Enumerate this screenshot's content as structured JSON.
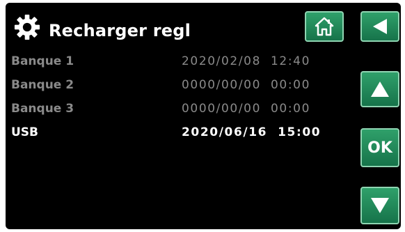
{
  "header": {
    "title": "Recharger regl",
    "icon": "gear-icon"
  },
  "buttons": {
    "home_icon": "home-icon",
    "back_icon": "back-arrow-icon",
    "up_icon": "up-arrow-icon",
    "ok_label": "OK",
    "down_icon": "down-arrow-icon"
  },
  "slots": [
    {
      "name": "Banque 1",
      "datetime": "2020/02/08  12:40"
    },
    {
      "name": "Banque 2",
      "datetime": "0000/00/00  00:00"
    },
    {
      "name": "Banque 3",
      "datetime": "0000/00/00  00:00"
    },
    {
      "name": "USB",
      "datetime": "2020/06/16  15:00"
    }
  ],
  "colors": {
    "background": "#000000",
    "button_green": "#1f8a57",
    "text_primary": "#ffffff",
    "text_dim": "#8a8a8a"
  }
}
